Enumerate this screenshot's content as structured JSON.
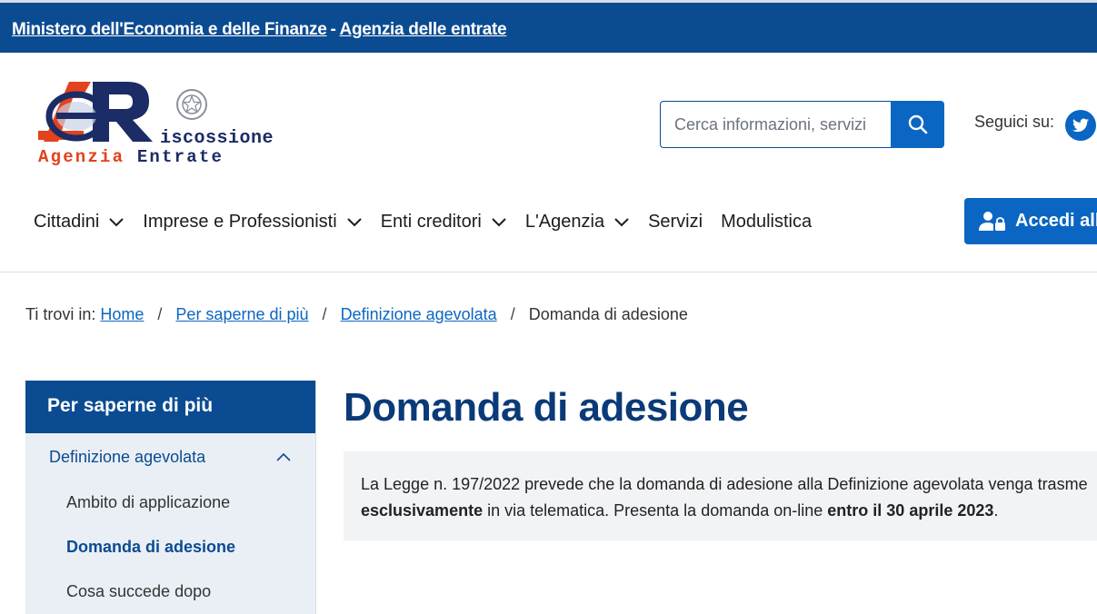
{
  "topbar": {
    "ministry_link": "Ministero dell'Economia e delle Finanze",
    "separator": "-",
    "agency_link": "Agenzia delle entrate"
  },
  "logo": {
    "mark_letters": "eR",
    "word1": "iscossione",
    "word2_part1": "Agenzia",
    "word2_part2": "Entrate"
  },
  "search": {
    "placeholder": "Cerca informazioni, servizi",
    "icon": "search-icon"
  },
  "social": {
    "label": "Seguici su:",
    "icon": "twitter-icon"
  },
  "nav": {
    "items": [
      {
        "label": "Cittadini",
        "has_dropdown": true
      },
      {
        "label": "Imprese e Professionisti",
        "has_dropdown": true
      },
      {
        "label": "Enti creditori",
        "has_dropdown": true
      },
      {
        "label": "L'Agenzia",
        "has_dropdown": true
      },
      {
        "label": "Servizi",
        "has_dropdown": false
      },
      {
        "label": "Modulistica",
        "has_dropdown": false
      }
    ],
    "login_label": "Accedi all"
  },
  "breadcrumb": {
    "prefix": "Ti trovi in:",
    "items": [
      "Home",
      "Per saperne di più",
      "Definizione agevolata"
    ],
    "current": "Domanda di adesione"
  },
  "sidebar": {
    "title": "Per saperne di più",
    "section": "Definizione agevolata",
    "items": [
      {
        "label": "Ambito di applicazione",
        "active": false
      },
      {
        "label": "Domanda di adesione",
        "active": true
      },
      {
        "label": "Cosa succede dopo",
        "active": false
      }
    ]
  },
  "main": {
    "title": "Domanda di adesione",
    "callout": {
      "line1": "La Legge n. 197/2022 prevede che la domanda di adesione alla Definizione agevolata venga trasme",
      "line2_bold1": "esclusivamente",
      "line2_text": " in via telematica. Presenta la domanda on-line ",
      "line2_bold2": "entro il 30 aprile 2023",
      "line2_end": "."
    }
  },
  "colors": {
    "primary_dark": "#0b4b91",
    "primary": "#0a66c2",
    "title": "#0b3a78",
    "logo_orange": "#e3421d",
    "logo_navy": "#1b2c66"
  }
}
